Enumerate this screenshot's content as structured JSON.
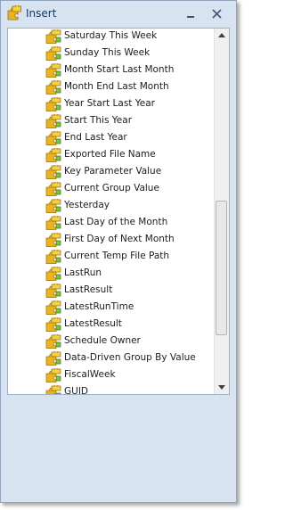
{
  "window": {
    "title": "Insert",
    "title_icon": "puzzle-pieces-icon",
    "minimize_icon": "minimize-icon",
    "close_icon": "close-icon"
  },
  "list": {
    "item_icon": "puzzle-pieces-icon",
    "items": [
      {
        "label": "Saturday This Week"
      },
      {
        "label": "Sunday This Week"
      },
      {
        "label": "Month Start Last Month"
      },
      {
        "label": "Month End Last Month"
      },
      {
        "label": "Year Start Last Year"
      },
      {
        "label": "Start This Year"
      },
      {
        "label": "End Last Year"
      },
      {
        "label": "Exported File Name"
      },
      {
        "label": "Key Parameter Value"
      },
      {
        "label": "Current Group Value"
      },
      {
        "label": "Yesterday"
      },
      {
        "label": "Last Day of the Month"
      },
      {
        "label": "First Day of Next Month"
      },
      {
        "label": "Current Temp File Path"
      },
      {
        "label": "LastRun"
      },
      {
        "label": "LastResult"
      },
      {
        "label": "LatestRunTime"
      },
      {
        "label": "LatestResult"
      },
      {
        "label": "Schedule Owner"
      },
      {
        "label": "Data-Driven Group By Value"
      },
      {
        "label": "FiscalWeek"
      },
      {
        "label": "GUID"
      }
    ]
  },
  "colors": {
    "frame": "#d7e3f1",
    "title_text": "#1a3a63",
    "icon_gold": "#e8b422",
    "icon_green": "#7cc23a"
  }
}
